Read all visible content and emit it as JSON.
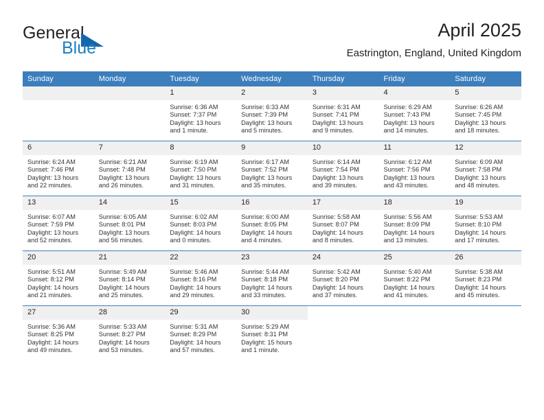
{
  "brand": {
    "word_one": "General",
    "word_two": "Blue",
    "logo_icon": "triangle-logo-icon",
    "accent_color": "#1466ad",
    "blue_text_color": "#1a7fc1"
  },
  "header": {
    "title": "April 2025",
    "subtitle": "Eastrington, England, United Kingdom"
  },
  "calendar": {
    "header_bg": "#3d7ebd",
    "daynum_bg": "#f0f0f0",
    "weekdays": [
      "Sunday",
      "Monday",
      "Tuesday",
      "Wednesday",
      "Thursday",
      "Friday",
      "Saturday"
    ],
    "weeks": [
      [
        {
          "day": "",
          "empty": true
        },
        {
          "day": "",
          "empty": true
        },
        {
          "day": "1",
          "sunrise": "Sunrise: 6:36 AM",
          "sunset": "Sunset: 7:37 PM",
          "daylight": "Daylight: 13 hours and 1 minute."
        },
        {
          "day": "2",
          "sunrise": "Sunrise: 6:33 AM",
          "sunset": "Sunset: 7:39 PM",
          "daylight": "Daylight: 13 hours and 5 minutes."
        },
        {
          "day": "3",
          "sunrise": "Sunrise: 6:31 AM",
          "sunset": "Sunset: 7:41 PM",
          "daylight": "Daylight: 13 hours and 9 minutes."
        },
        {
          "day": "4",
          "sunrise": "Sunrise: 6:29 AM",
          "sunset": "Sunset: 7:43 PM",
          "daylight": "Daylight: 13 hours and 14 minutes."
        },
        {
          "day": "5",
          "sunrise": "Sunrise: 6:26 AM",
          "sunset": "Sunset: 7:45 PM",
          "daylight": "Daylight: 13 hours and 18 minutes."
        }
      ],
      [
        {
          "day": "6",
          "sunrise": "Sunrise: 6:24 AM",
          "sunset": "Sunset: 7:46 PM",
          "daylight": "Daylight: 13 hours and 22 minutes."
        },
        {
          "day": "7",
          "sunrise": "Sunrise: 6:21 AM",
          "sunset": "Sunset: 7:48 PM",
          "daylight": "Daylight: 13 hours and 26 minutes."
        },
        {
          "day": "8",
          "sunrise": "Sunrise: 6:19 AM",
          "sunset": "Sunset: 7:50 PM",
          "daylight": "Daylight: 13 hours and 31 minutes."
        },
        {
          "day": "9",
          "sunrise": "Sunrise: 6:17 AM",
          "sunset": "Sunset: 7:52 PM",
          "daylight": "Daylight: 13 hours and 35 minutes."
        },
        {
          "day": "10",
          "sunrise": "Sunrise: 6:14 AM",
          "sunset": "Sunset: 7:54 PM",
          "daylight": "Daylight: 13 hours and 39 minutes."
        },
        {
          "day": "11",
          "sunrise": "Sunrise: 6:12 AM",
          "sunset": "Sunset: 7:56 PM",
          "daylight": "Daylight: 13 hours and 43 minutes."
        },
        {
          "day": "12",
          "sunrise": "Sunrise: 6:09 AM",
          "sunset": "Sunset: 7:58 PM",
          "daylight": "Daylight: 13 hours and 48 minutes."
        }
      ],
      [
        {
          "day": "13",
          "sunrise": "Sunrise: 6:07 AM",
          "sunset": "Sunset: 7:59 PM",
          "daylight": "Daylight: 13 hours and 52 minutes."
        },
        {
          "day": "14",
          "sunrise": "Sunrise: 6:05 AM",
          "sunset": "Sunset: 8:01 PM",
          "daylight": "Daylight: 13 hours and 56 minutes."
        },
        {
          "day": "15",
          "sunrise": "Sunrise: 6:02 AM",
          "sunset": "Sunset: 8:03 PM",
          "daylight": "Daylight: 14 hours and 0 minutes."
        },
        {
          "day": "16",
          "sunrise": "Sunrise: 6:00 AM",
          "sunset": "Sunset: 8:05 PM",
          "daylight": "Daylight: 14 hours and 4 minutes."
        },
        {
          "day": "17",
          "sunrise": "Sunrise: 5:58 AM",
          "sunset": "Sunset: 8:07 PM",
          "daylight": "Daylight: 14 hours and 8 minutes."
        },
        {
          "day": "18",
          "sunrise": "Sunrise: 5:56 AM",
          "sunset": "Sunset: 8:09 PM",
          "daylight": "Daylight: 14 hours and 13 minutes."
        },
        {
          "day": "19",
          "sunrise": "Sunrise: 5:53 AM",
          "sunset": "Sunset: 8:10 PM",
          "daylight": "Daylight: 14 hours and 17 minutes."
        }
      ],
      [
        {
          "day": "20",
          "sunrise": "Sunrise: 5:51 AM",
          "sunset": "Sunset: 8:12 PM",
          "daylight": "Daylight: 14 hours and 21 minutes."
        },
        {
          "day": "21",
          "sunrise": "Sunrise: 5:49 AM",
          "sunset": "Sunset: 8:14 PM",
          "daylight": "Daylight: 14 hours and 25 minutes."
        },
        {
          "day": "22",
          "sunrise": "Sunrise: 5:46 AM",
          "sunset": "Sunset: 8:16 PM",
          "daylight": "Daylight: 14 hours and 29 minutes."
        },
        {
          "day": "23",
          "sunrise": "Sunrise: 5:44 AM",
          "sunset": "Sunset: 8:18 PM",
          "daylight": "Daylight: 14 hours and 33 minutes."
        },
        {
          "day": "24",
          "sunrise": "Sunrise: 5:42 AM",
          "sunset": "Sunset: 8:20 PM",
          "daylight": "Daylight: 14 hours and 37 minutes."
        },
        {
          "day": "25",
          "sunrise": "Sunrise: 5:40 AM",
          "sunset": "Sunset: 8:22 PM",
          "daylight": "Daylight: 14 hours and 41 minutes."
        },
        {
          "day": "26",
          "sunrise": "Sunrise: 5:38 AM",
          "sunset": "Sunset: 8:23 PM",
          "daylight": "Daylight: 14 hours and 45 minutes."
        }
      ],
      [
        {
          "day": "27",
          "sunrise": "Sunrise: 5:36 AM",
          "sunset": "Sunset: 8:25 PM",
          "daylight": "Daylight: 14 hours and 49 minutes."
        },
        {
          "day": "28",
          "sunrise": "Sunrise: 5:33 AM",
          "sunset": "Sunset: 8:27 PM",
          "daylight": "Daylight: 14 hours and 53 minutes."
        },
        {
          "day": "29",
          "sunrise": "Sunrise: 5:31 AM",
          "sunset": "Sunset: 8:29 PM",
          "daylight": "Daylight: 14 hours and 57 minutes."
        },
        {
          "day": "30",
          "sunrise": "Sunrise: 5:29 AM",
          "sunset": "Sunset: 8:31 PM",
          "daylight": "Daylight: 15 hours and 1 minute."
        },
        {
          "day": "",
          "blank": true
        },
        {
          "day": "",
          "blank": true
        },
        {
          "day": "",
          "blank": true
        }
      ]
    ]
  }
}
